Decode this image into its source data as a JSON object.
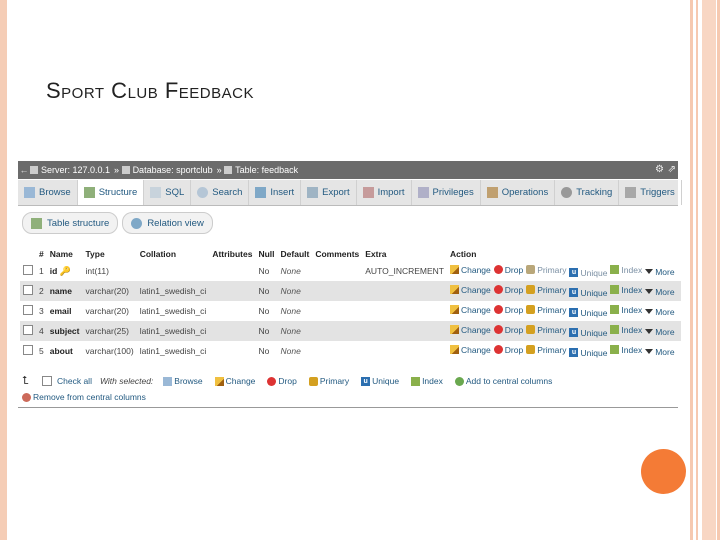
{
  "slide": {
    "title": "Sport Club Feedback",
    "accent": "#f47b36"
  },
  "breadcrumb": [
    {
      "label": "Server: 127.0.0.1",
      "icon": "server-icon"
    },
    {
      "label": "Database: sportclub",
      "icon": "database-icon"
    },
    {
      "label": "Table: feedback",
      "icon": "table-icon"
    }
  ],
  "tabs": [
    {
      "label": "Browse",
      "icon": "browse-icon"
    },
    {
      "label": "Structure",
      "icon": "structure-icon",
      "active": true
    },
    {
      "label": "SQL",
      "icon": "sql-icon"
    },
    {
      "label": "Search",
      "icon": "search-icon"
    },
    {
      "label": "Insert",
      "icon": "insert-icon"
    },
    {
      "label": "Export",
      "icon": "export-icon"
    },
    {
      "label": "Import",
      "icon": "import-icon"
    },
    {
      "label": "Privileges",
      "icon": "privileges-icon"
    },
    {
      "label": "Operations",
      "icon": "operations-icon"
    },
    {
      "label": "Tracking",
      "icon": "tracking-icon"
    },
    {
      "label": "Triggers",
      "icon": "triggers-icon"
    }
  ],
  "subtabs": [
    {
      "label": "Table structure",
      "icon": "table-structure-icon"
    },
    {
      "label": "Relation view",
      "icon": "relation-view-icon"
    }
  ],
  "columns": [
    "#",
    "Name",
    "Type",
    "Collation",
    "Attributes",
    "Null",
    "Default",
    "Comments",
    "Extra",
    "Action"
  ],
  "rows": [
    {
      "num": "1",
      "name": "id",
      "type": "int(11)",
      "collation": "",
      "attributes": "",
      "null": "No",
      "default": "None",
      "comments": "",
      "extra": "AUTO_INCREMENT",
      "primary_key": true
    },
    {
      "num": "2",
      "name": "name",
      "type": "varchar(20)",
      "collation": "latin1_swedish_ci",
      "attributes": "",
      "null": "No",
      "default": "None",
      "comments": "",
      "extra": ""
    },
    {
      "num": "3",
      "name": "email",
      "type": "varchar(20)",
      "collation": "latin1_swedish_ci",
      "attributes": "",
      "null": "No",
      "default": "None",
      "comments": "",
      "extra": ""
    },
    {
      "num": "4",
      "name": "subject",
      "type": "varchar(25)",
      "collation": "latin1_swedish_ci",
      "attributes": "",
      "null": "No",
      "default": "None",
      "comments": "",
      "extra": ""
    },
    {
      "num": "5",
      "name": "about",
      "type": "varchar(100)",
      "collation": "latin1_swedish_ci",
      "attributes": "",
      "null": "No",
      "default": "None",
      "comments": "",
      "extra": ""
    }
  ],
  "row_actions": {
    "change": "Change",
    "drop": "Drop",
    "primary": "Primary",
    "unique": "Unique",
    "index": "Index",
    "more": "More"
  },
  "footer": {
    "check_all": "Check all",
    "with_selected": "With selected:",
    "browse": "Browse",
    "change": "Change",
    "drop": "Drop",
    "primary": "Primary",
    "unique": "Unique",
    "index": "Index",
    "add_central": "Add to central columns",
    "remove_central": "Remove from central columns"
  }
}
